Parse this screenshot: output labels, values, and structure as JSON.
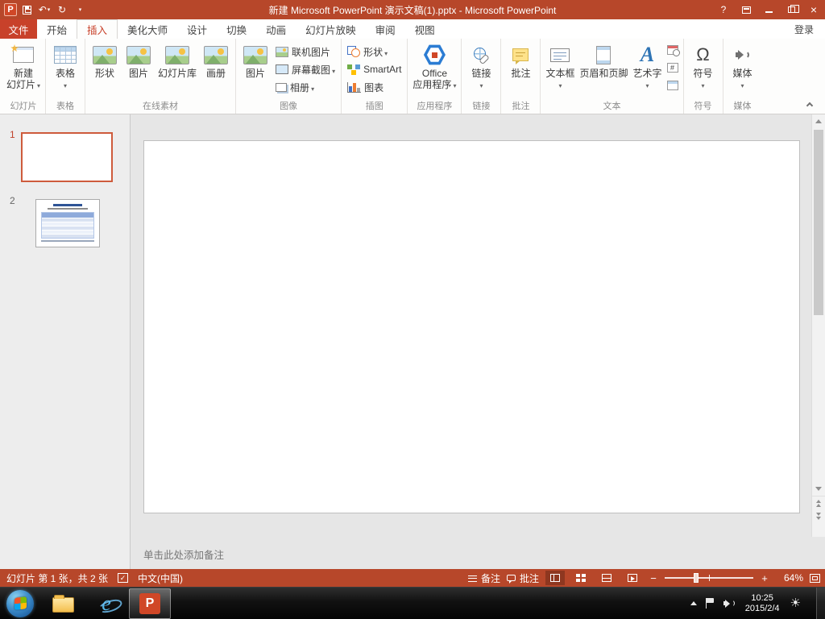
{
  "window": {
    "title": "新建 Microsoft PowerPoint 演示文稿(1).pptx - Microsoft PowerPoint",
    "help": "?"
  },
  "tab_bar": {
    "file": "文件",
    "tabs": [
      "开始",
      "插入",
      "美化大师",
      "设计",
      "切换",
      "动画",
      "幻灯片放映",
      "审阅",
      "视图"
    ],
    "active_tab": "插入",
    "sign_in": "登录"
  },
  "ribbon": {
    "slides": {
      "group": "幻灯片",
      "new_slide_line1": "新建",
      "new_slide_line2": "幻灯片"
    },
    "tables": {
      "group": "表格",
      "table": "表格"
    },
    "online_assets": {
      "group": "在线素材",
      "shapes": "形状",
      "pictures": "图片",
      "slide_library": "幻灯片库",
      "album": "画册"
    },
    "images": {
      "group": "图像",
      "picture": "图片",
      "online_pictures": "联机图片",
      "screenshot": "屏幕截图",
      "photo_album": "相册"
    },
    "illustrations": {
      "group": "插图",
      "shapes": "形状",
      "smartart": "SmartArt",
      "chart": "图表"
    },
    "applications": {
      "group": "应用程序",
      "office_line1": "Office",
      "office_line2": "应用程序"
    },
    "links": {
      "group": "链接",
      "link": "链接"
    },
    "comments": {
      "group": "批注",
      "comment": "批注"
    },
    "text": {
      "group": "文本",
      "textbox": "文本框",
      "header_footer": "页眉和页脚",
      "wordart": "艺术字"
    },
    "symbols": {
      "group": "符号",
      "symbol": "符号",
      "omega": "Ω"
    },
    "media": {
      "group": "媒体",
      "media": "媒体"
    }
  },
  "slide_panel": {
    "slide1_number": "1",
    "slide2_number": "2"
  },
  "notes": {
    "placeholder": "单击此处添加备注"
  },
  "status_bar": {
    "slide_info": "幻灯片 第 1 张，共 2 张",
    "language": "中文(中国)",
    "notes_label": "备注",
    "comments_label": "批注",
    "zoom_percent": "64%"
  },
  "taskbar": {
    "time": "10:25",
    "date": "2015/2/4"
  },
  "colors": {
    "accent": "#B7472A",
    "file_tab": "#C8412A",
    "selected_slide_border": "#CE5B3C",
    "taskbar": "#111111"
  }
}
